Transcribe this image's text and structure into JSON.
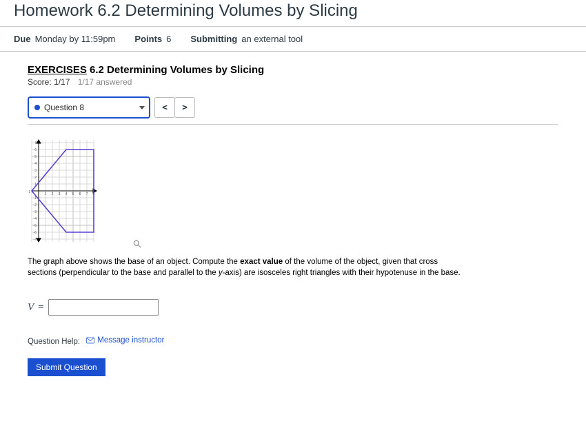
{
  "header": {
    "title": "Homework 6.2 Determining Volumes by Slicing"
  },
  "meta": {
    "due_label": "Due",
    "due_value": "Monday by 11:59pm",
    "points_label": "Points",
    "points_value": "6",
    "submitting_label": "Submitting",
    "submitting_value": "an external tool"
  },
  "exercise": {
    "title_underlined": "EXERCISES",
    "title_rest": " 6.2 Determining Volumes by Slicing",
    "score_label": "Score: ",
    "score_value": "1/17",
    "answered": "1/17 answered"
  },
  "questionNav": {
    "selected": "Question 8",
    "prev": "<",
    "next": ">"
  },
  "graph": {
    "x_range": [
      -1,
      8
    ],
    "y_range": [
      -7,
      7
    ],
    "x_ticks": [
      "-1",
      "1",
      "2",
      "3",
      "4",
      "5",
      "6",
      "7",
      "8"
    ],
    "y_ticks": [
      "-7",
      "-6",
      "-5",
      "-4",
      "-3",
      "-2",
      "-1",
      "1",
      "2",
      "3",
      "4",
      "5",
      "6",
      "7"
    ],
    "polygon_vertices": [
      [
        -1,
        0
      ],
      [
        4,
        6
      ],
      [
        8,
        6
      ],
      [
        8,
        -6
      ],
      [
        4,
        -6
      ]
    ]
  },
  "question": {
    "text_prefix": "The graph above shows the base of an object. Compute the ",
    "text_bold": "exact value",
    "text_mid": " of the volume of the object, given that cross sections (perpendicular to the base and parallel to the ",
    "text_ital": "y",
    "text_suffix": "-axis) are isosceles right triangles with their hypotenuse in the base."
  },
  "answer": {
    "var": "V",
    "equals": "=",
    "value": ""
  },
  "help": {
    "label": "Question Help:",
    "message": "Message instructor"
  },
  "buttons": {
    "submit": "Submit Question"
  }
}
